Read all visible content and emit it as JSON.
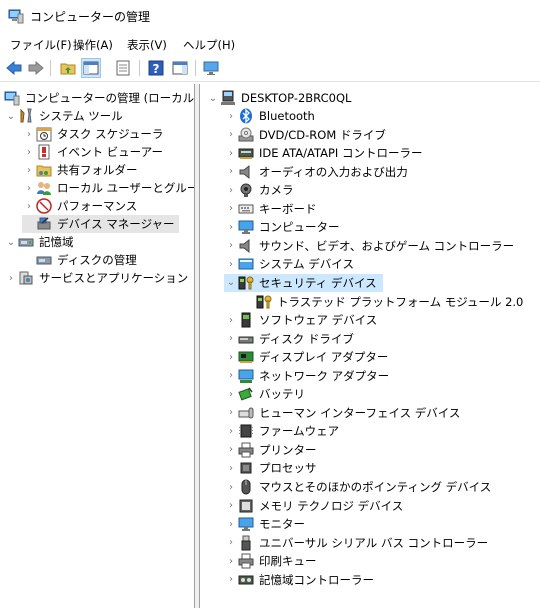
{
  "window": {
    "title": "コンピューターの管理"
  },
  "menu": [
    {
      "label": "ファイル(F)"
    },
    {
      "label": "操作(A)"
    },
    {
      "label": "表示(V)"
    },
    {
      "label": "ヘルプ(H)"
    }
  ],
  "toolbar": [
    {
      "name": "back-button",
      "icon": "back-arrow-icon"
    },
    {
      "name": "forward-button",
      "icon": "forward-arrow-icon"
    },
    {
      "name": "up-folder-button",
      "icon": "folder-up-icon"
    },
    {
      "name": "show-hide-tree-button",
      "icon": "console-tree-icon"
    },
    {
      "name": "properties-button",
      "icon": "properties-icon"
    },
    {
      "name": "help-button",
      "icon": "help-icon"
    },
    {
      "name": "show-action-pane-button",
      "icon": "action-pane-icon"
    },
    {
      "name": "monitor-button",
      "icon": "monitor-icon"
    }
  ],
  "tree": {
    "root": {
      "label": "コンピューターの管理 (ローカル)"
    },
    "system_tools": {
      "label": "システム ツール"
    },
    "task_scheduler": {
      "label": "タスク スケジューラ"
    },
    "event_viewer": {
      "label": "イベント ビューアー"
    },
    "shared_folders": {
      "label": "共有フォルダー"
    },
    "local_users": {
      "label": "ローカル ユーザーとグループ"
    },
    "performance": {
      "label": "パフォーマンス"
    },
    "device_manager": {
      "label": "デバイス マネージャー"
    },
    "storage": {
      "label": "記憶域"
    },
    "disk_management": {
      "label": "ディスクの管理"
    },
    "services_apps": {
      "label": "サービスとアプリケーション"
    }
  },
  "devices": {
    "computer": "DESKTOP-2BRC0QL",
    "items": [
      {
        "label": "Bluetooth",
        "icon": "bluetooth-icon"
      },
      {
        "label": "DVD/CD-ROM ドライブ",
        "icon": "dvd-drive-icon"
      },
      {
        "label": "IDE ATA/ATAPI コントローラー",
        "icon": "ide-controller-icon"
      },
      {
        "label": "オーディオの入力および出力",
        "icon": "speaker-icon"
      },
      {
        "label": "カメラ",
        "icon": "camera-icon"
      },
      {
        "label": "キーボード",
        "icon": "keyboard-icon"
      },
      {
        "label": "コンピューター",
        "icon": "computer-icon"
      },
      {
        "label": "サウンド、ビデオ、およびゲーム コントローラー",
        "icon": "speaker-icon"
      },
      {
        "label": "システム デバイス",
        "icon": "system-device-icon"
      },
      {
        "label": "セキュリティ デバイス",
        "icon": "security-key-icon"
      },
      {
        "label": "トラステッド プラットフォーム モジュール 2.0",
        "icon": "security-key-icon"
      },
      {
        "label": "ソフトウェア デバイス",
        "icon": "software-device-icon"
      },
      {
        "label": "ディスク ドライブ",
        "icon": "disk-drive-icon"
      },
      {
        "label": "ディスプレイ アダプター",
        "icon": "display-adapter-icon"
      },
      {
        "label": "ネットワーク アダプター",
        "icon": "network-adapter-icon"
      },
      {
        "label": "バッテリ",
        "icon": "battery-icon"
      },
      {
        "label": "ヒューマン インターフェイス デバイス",
        "icon": "hid-icon"
      },
      {
        "label": "ファームウェア",
        "icon": "firmware-icon"
      },
      {
        "label": "プリンター",
        "icon": "printer-icon"
      },
      {
        "label": "プロセッサ",
        "icon": "processor-icon"
      },
      {
        "label": "マウスとそのほかのポインティング デバイス",
        "icon": "mouse-icon"
      },
      {
        "label": "メモリ テクノロジ デバイス",
        "icon": "memory-icon"
      },
      {
        "label": "モニター",
        "icon": "monitor-icon"
      },
      {
        "label": "ユニバーサル シリアル バス コントローラー",
        "icon": "usb-icon"
      },
      {
        "label": "印刷キュー",
        "icon": "print-queue-icon"
      },
      {
        "label": "記憶域コントローラー",
        "icon": "storage-controller-icon"
      }
    ]
  }
}
